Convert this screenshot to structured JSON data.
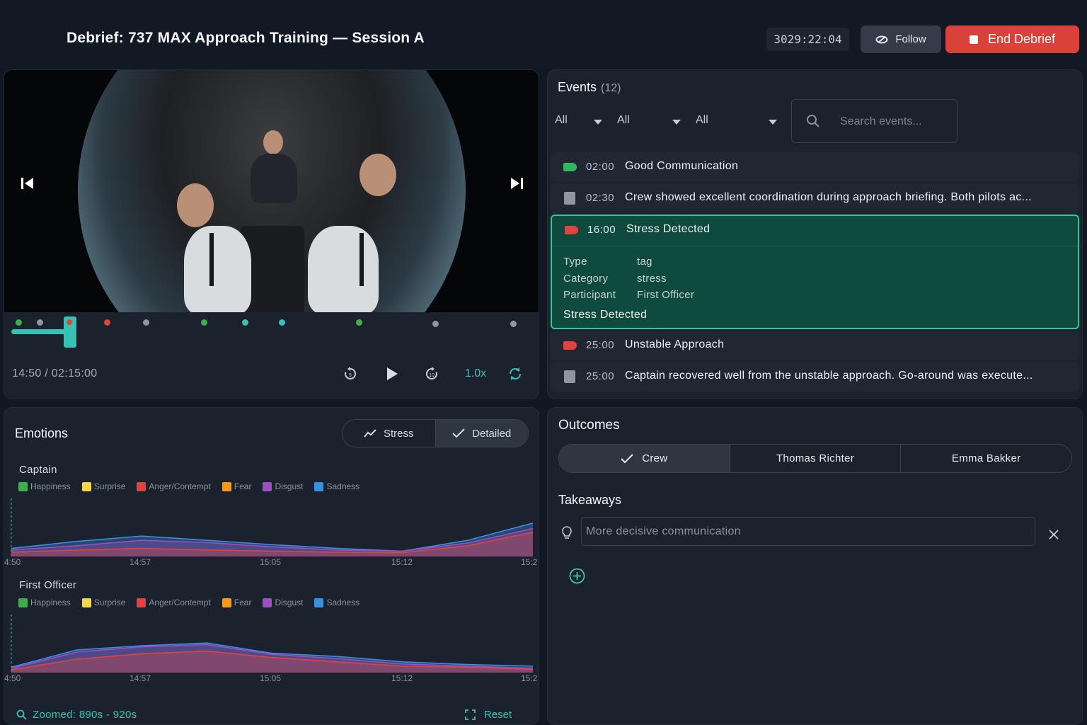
{
  "header": {
    "title": "Debrief: 737 MAX Approach Training — Session A",
    "timer": "3029:22:04",
    "follow_label": "Follow",
    "end_label": "End Debrief"
  },
  "player": {
    "time_display": "14:50 / 02:15:00",
    "speed": "1.0x"
  },
  "events": {
    "title": "Events",
    "count": "(12)",
    "filters": [
      "All",
      "All",
      "All"
    ],
    "search_placeholder": "Search events...",
    "items": [
      {
        "time": "02:00",
        "label": "Good Communication",
        "kind": "tag",
        "color": "#2fb860"
      },
      {
        "time": "02:30",
        "label": "Crew showed excellent coordination during approach briefing. Both pilots ac...",
        "kind": "note"
      },
      {
        "time": "16:00",
        "label": "Stress Detected",
        "kind": "tag",
        "color": "#e0453d"
      },
      {
        "time": "25:00",
        "label": "Unstable Approach",
        "kind": "tag",
        "color": "#e0453d"
      },
      {
        "time": "25:00",
        "label": "Captain recovered well from the unstable approach. Go-around was execute...",
        "kind": "note"
      }
    ],
    "selected_detail": {
      "type_label": "Type",
      "type_value": "tag",
      "category_label": "Category",
      "category_value": "stress",
      "participant_label": "Participant",
      "participant_value": "First Officer",
      "description": "Stress Detected"
    }
  },
  "emotions": {
    "title": "Emotions",
    "modes": [
      "Stress",
      "Detailed"
    ],
    "active_mode": "Detailed",
    "legend": [
      {
        "name": "Happiness",
        "color": "#3fae4a"
      },
      {
        "name": "Surprise",
        "color": "#f2d64b"
      },
      {
        "name": "Anger/Contempt",
        "color": "#e0453d"
      },
      {
        "name": "Fear",
        "color": "#f39a1e"
      },
      {
        "name": "Disgust",
        "color": "#9b4fc4"
      },
      {
        "name": "Sadness",
        "color": "#3a8fe0"
      }
    ],
    "captain_label": "Captain",
    "fo_label": "First Officer",
    "x_ticks": [
      "4:50",
      "14:57",
      "15:05",
      "15:12",
      "15:2"
    ],
    "zoom_text": "Zoomed: 890s - 920s",
    "reset_label": "Reset"
  },
  "chart_data": [
    {
      "type": "area",
      "title": "Captain",
      "x": [
        "14:50",
        "14:53",
        "14:57",
        "15:01",
        "15:05",
        "15:08",
        "15:12",
        "15:16",
        "15:20"
      ],
      "series": [
        {
          "name": "Sadness",
          "values": [
            0.15,
            0.28,
            0.38,
            0.3,
            0.22,
            0.15,
            0.1,
            0.3,
            0.62
          ]
        },
        {
          "name": "Disgust",
          "values": [
            0.12,
            0.2,
            0.3,
            0.26,
            0.18,
            0.12,
            0.1,
            0.25,
            0.52
          ]
        },
        {
          "name": "Anger/Contempt",
          "values": [
            0.08,
            0.12,
            0.15,
            0.12,
            0.1,
            0.08,
            0.07,
            0.2,
            0.45
          ]
        }
      ],
      "ylim": [
        0,
        1
      ]
    },
    {
      "type": "area",
      "title": "First Officer",
      "x": [
        "14:50",
        "14:53",
        "14:57",
        "15:01",
        "15:05",
        "15:08",
        "15:12",
        "15:16",
        "15:20"
      ],
      "series": [
        {
          "name": "Sadness",
          "values": [
            0.1,
            0.42,
            0.5,
            0.55,
            0.36,
            0.3,
            0.2,
            0.15,
            0.12
          ]
        },
        {
          "name": "Disgust",
          "values": [
            0.08,
            0.38,
            0.48,
            0.52,
            0.34,
            0.26,
            0.16,
            0.12,
            0.08
          ]
        },
        {
          "name": "Anger/Contempt",
          "values": [
            0.05,
            0.25,
            0.35,
            0.4,
            0.28,
            0.2,
            0.12,
            0.1,
            0.06
          ]
        }
      ],
      "ylim": [
        0,
        1
      ]
    }
  ],
  "outcomes": {
    "title": "Outcomes",
    "tabs": [
      "Crew",
      "Thomas Richter",
      "Emma Bakker"
    ],
    "takeaways_title": "Takeaways",
    "takeaway_value": "More decisive communication"
  }
}
